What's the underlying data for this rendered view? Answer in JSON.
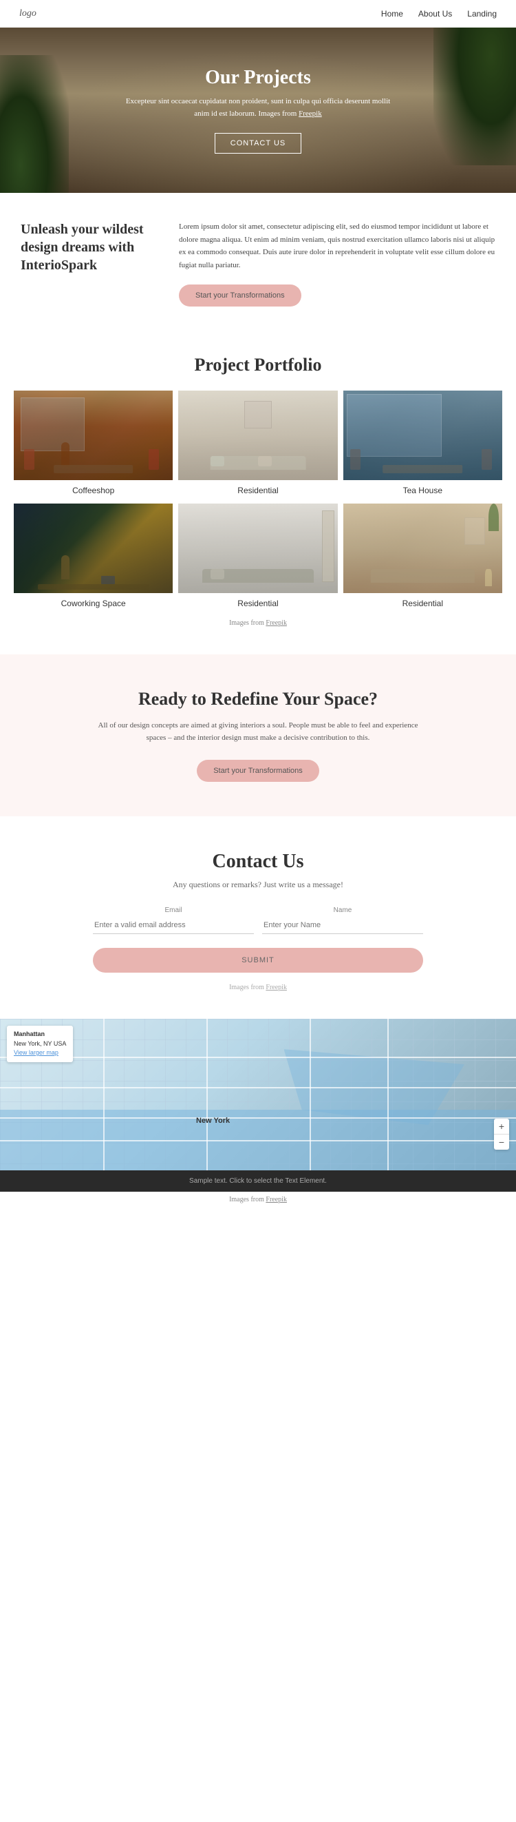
{
  "nav": {
    "logo": "logo",
    "links": [
      {
        "label": "Home",
        "href": "#"
      },
      {
        "label": "About Us",
        "href": "#"
      },
      {
        "label": "Landing",
        "href": "#"
      }
    ]
  },
  "hero": {
    "title": "Our Projects",
    "description": "Excepteur sint occaecat cupidatat non proident, sunt in culpa qui officia deserunt mollit anim id est laborum. Images from",
    "freepik_link": "Freepik",
    "cta_button": "CONTACT US"
  },
  "about": {
    "heading": "Unleash your wildest design dreams with InterioSpark",
    "body": "Lorem ipsum dolor sit amet, consectetur adipiscing elit, sed do eiusmod tempor incididunt ut labore et dolore magna aliqua. Ut enim ad minim veniam, quis nostrud exercitation ullamco laboris nisi ut aliquip ex ea commodo consequat. Duis aute irure dolor in reprehenderit in voluptate velit esse cillum dolore eu fugiat nulla pariatur.",
    "cta_button": "Start your Transformations"
  },
  "portfolio": {
    "section_title": "Project Portfolio",
    "items": [
      {
        "label": "Coffeeshop"
      },
      {
        "label": "Residential"
      },
      {
        "label": "Tea House"
      },
      {
        "label": "Coworking Space"
      },
      {
        "label": "Residential"
      },
      {
        "label": "Residential"
      }
    ],
    "note": "Images from",
    "freepik_link": "Freepik"
  },
  "redefine": {
    "title": "Ready to Redefine Your Space?",
    "description": "All of our design concepts are aimed at giving interiors a soul. People must be able to feel and experience spaces – and the interior design must make a decisive contribution to this.",
    "cta_button": "Start your Transformations"
  },
  "contact": {
    "title": "Contact Us",
    "subtitle": "Any questions or remarks? Just write us a message!",
    "email_label": "Email",
    "email_placeholder": "Enter a valid email address",
    "name_label": "Name",
    "name_placeholder": "Enter your Name",
    "submit_button": "SUBMIT",
    "note": "Images from",
    "freepik_link": "Freepik"
  },
  "map": {
    "location_title": "Manhattan",
    "location_address": "New York, NY USA",
    "view_larger": "View larger map",
    "city_label": "New York",
    "zoom_in": "+",
    "zoom_out": "−"
  },
  "footer": {
    "text": "Sample text. Click to select the Text Element.",
    "note": "Images from",
    "freepik_link": "Freepik"
  }
}
